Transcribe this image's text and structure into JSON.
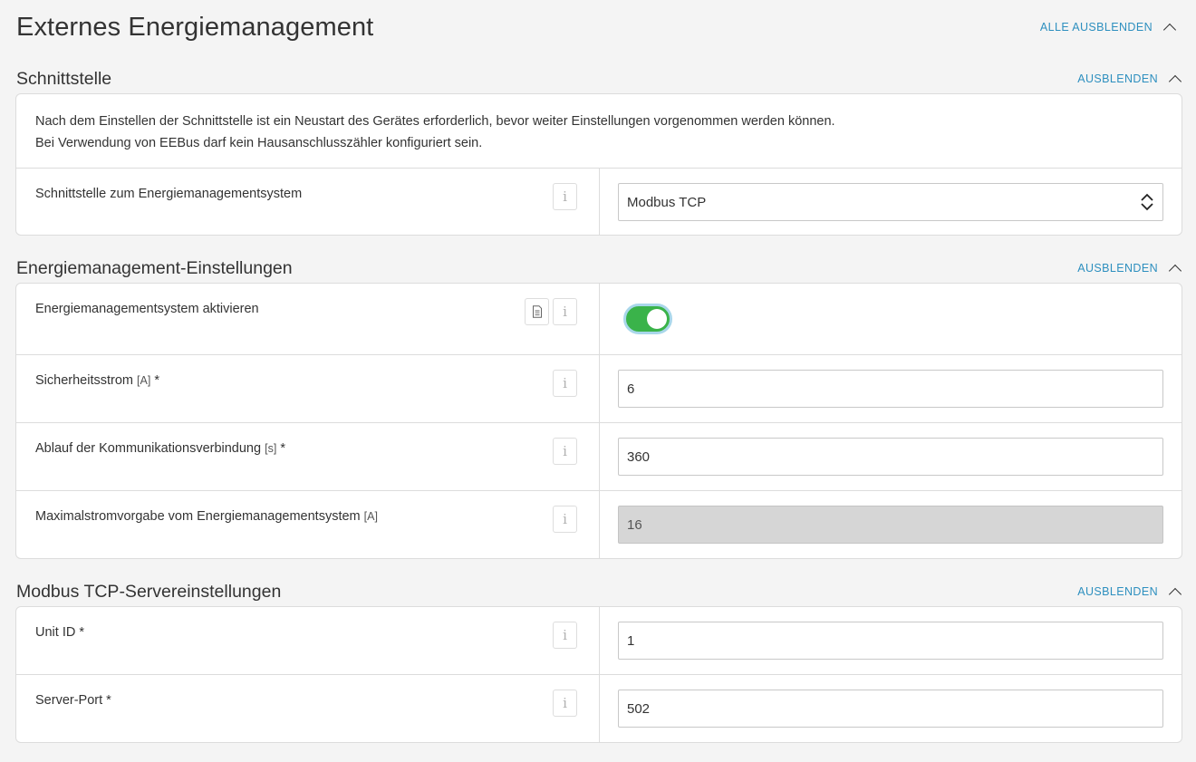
{
  "page": {
    "title": "Externes Energiemanagement",
    "collapse_all": "ALLE AUSBLENDEN"
  },
  "sections": {
    "interface": {
      "title": "Schnittstelle",
      "collapse": "AUSBLENDEN",
      "note_line1": "Nach dem Einstellen der Schnittstelle ist ein Neustart des Gerätes erforderlich, bevor weiter Einstellungen vorgenommen werden können.",
      "note_line2": "Bei Verwendung von EEBus darf kein Hausanschlusszähler konfiguriert sein.",
      "interface_label": "Schnittstelle zum Energiemanagementsystem",
      "interface_value": "Modbus TCP"
    },
    "settings": {
      "title": "Energiemanagement-Einstellungen",
      "collapse": "AUSBLENDEN",
      "activate_label": "Energiemanagementsystem aktivieren",
      "activate_state": "on",
      "safety_label": "Sicherheitsstrom",
      "safety_unit": "[A]",
      "safety_required": "*",
      "safety_value": "6",
      "timeout_label": "Ablauf der Kommunikationsverbindung",
      "timeout_unit": "[s]",
      "timeout_required": "*",
      "timeout_value": "360",
      "maxcurrent_label": "Maximalstromvorgabe vom Energiemanagementsystem",
      "maxcurrent_unit": "[A]",
      "maxcurrent_value": "16"
    },
    "modbus": {
      "title": "Modbus TCP-Servereinstellungen",
      "collapse": "AUSBLENDEN",
      "unitid_label": "Unit ID *",
      "unitid_value": "1",
      "port_label": "Server-Port *",
      "port_value": "502"
    }
  },
  "icons": {
    "info": "i",
    "info_icon": "info-icon",
    "doc_icon": "document-icon",
    "chevron": "chevron-up-icon",
    "select_arrows": "updown-arrows-icon"
  },
  "colors": {
    "accent": "#2d8fbf",
    "toggle_on": "#3ab34a",
    "toggle_focus": "#a9d7ea",
    "disabled_field": "#d6d6d6"
  }
}
